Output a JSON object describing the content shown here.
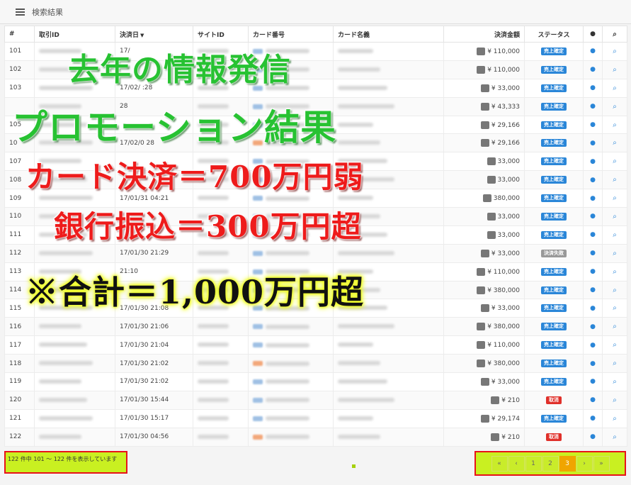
{
  "panel": {
    "title": "検索結果",
    "icon": "list-icon"
  },
  "table": {
    "headers": {
      "num": "#",
      "id": "取引ID",
      "date": "決済日",
      "site": "サイトID",
      "card_number": "カード番号",
      "card_name": "カード名義",
      "amount": "決済金額",
      "status": "ステータス"
    },
    "header_icons": {
      "user": "user-icon",
      "search": "search-icon",
      "sort": "sort-caret-icon"
    },
    "rows": [
      {
        "num": "101",
        "date": "17/",
        "amount": "¥ 110,000",
        "status": "売上確定",
        "status_type": "ok"
      },
      {
        "num": "102",
        "date": "",
        "amount": "¥ 110,000",
        "status": "売上確定",
        "status_type": "ok"
      },
      {
        "num": "103",
        "date": "17/02/ :28",
        "amount": "¥ 33,000",
        "status": "売上確定",
        "status_type": "ok"
      },
      {
        "num": "",
        "date": "28",
        "amount": "¥ 43,333",
        "status": "売上確定",
        "status_type": "ok"
      },
      {
        "num": "105",
        "date": "",
        "amount": "¥ 29,166",
        "status": "売上確定",
        "status_type": "ok"
      },
      {
        "num": "10",
        "date": "17/02/0 28",
        "amount": "¥ 29,166",
        "status": "売上確定",
        "status_type": "ok"
      },
      {
        "num": "107",
        "date": "",
        "amount": "33,000",
        "status": "売上確定",
        "status_type": "ok"
      },
      {
        "num": "108",
        "date": "",
        "amount": "33,000",
        "status": "売上確定",
        "status_type": "ok"
      },
      {
        "num": "109",
        "date": "17/01/31 04:21",
        "amount": "380,000",
        "status": "売上確定",
        "status_type": "ok"
      },
      {
        "num": "110",
        "date": "",
        "amount": "33,000",
        "status": "売上確定",
        "status_type": "ok"
      },
      {
        "num": "111",
        "date": "",
        "amount": "33,000",
        "status": "売上確定",
        "status_type": "ok"
      },
      {
        "num": "112",
        "date": "17/01/30 21:29",
        "amount": "¥ 33,000",
        "status": "決済失敗",
        "status_type": "fail"
      },
      {
        "num": "113",
        "date": "21:10",
        "amount": "¥ 110,000",
        "status": "売上確定",
        "status_type": "ok"
      },
      {
        "num": "114",
        "date": "",
        "amount": "¥ 380,000",
        "status": "売上確定",
        "status_type": "ok"
      },
      {
        "num": "115",
        "date": "17/01/30 21:08",
        "amount": "¥ 33,000",
        "status": "売上確定",
        "status_type": "ok"
      },
      {
        "num": "116",
        "date": "17/01/30 21:06",
        "amount": "¥ 380,000",
        "status": "売上確定",
        "status_type": "ok"
      },
      {
        "num": "117",
        "date": "17/01/30 21:04",
        "amount": "¥ 110,000",
        "status": "売上確定",
        "status_type": "ok"
      },
      {
        "num": "118",
        "date": "17/01/30 21:02",
        "amount": "¥ 380,000",
        "status": "売上確定",
        "status_type": "ok"
      },
      {
        "num": "119",
        "date": "17/01/30 21:02",
        "amount": "¥ 33,000",
        "status": "売上確定",
        "status_type": "ok"
      },
      {
        "num": "120",
        "date": "17/01/30 15:44",
        "amount": "¥ 210",
        "status": "取消",
        "status_type": "cancel"
      },
      {
        "num": "121",
        "date": "17/01/30 15:17",
        "amount": "¥ 29,174",
        "status": "売上確定",
        "status_type": "ok"
      },
      {
        "num": "122",
        "date": "17/01/30 04:56",
        "amount": "¥ 210",
        "status": "取消",
        "status_type": "cancel"
      }
    ]
  },
  "footer": {
    "info": "122 件中 101 ～ 122 件を表示しています"
  },
  "pagination": {
    "buttons": [
      "«",
      "‹",
      "1",
      "2",
      "3",
      "›",
      "»"
    ],
    "active": "3"
  },
  "overlay": {
    "line1": "去年の情報発信",
    "line2": "プロモーション結果",
    "line3": "カード決済＝700万円弱",
    "line4": "銀行振込＝300万円超",
    "line5": "※合計＝1,000万円超"
  },
  "colors": {
    "accent_blue": "#2a86d8",
    "highlight_green": "#c9f021",
    "frame_red": "#e8121a",
    "overlay_green": "#27c232",
    "overlay_red": "#ee1b1b"
  }
}
